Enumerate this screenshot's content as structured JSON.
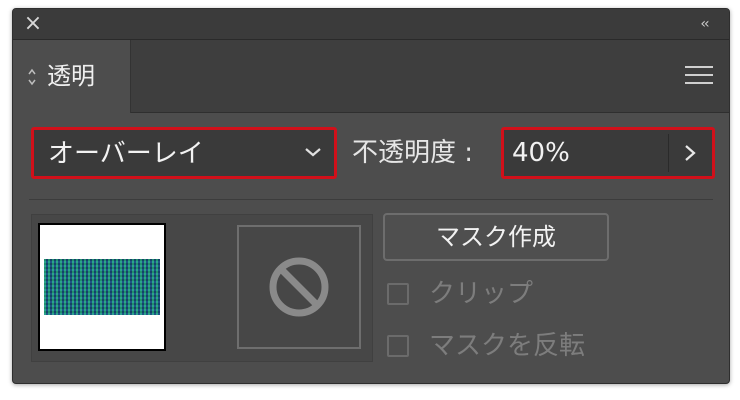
{
  "titlebar": {
    "close_icon": "close-icon",
    "collapse_label": "‹‹"
  },
  "tab": {
    "label": "透明",
    "arrows_icon": "up-down-arrows-icon"
  },
  "menu_icon": "hamburger-menu-icon",
  "blend_mode": {
    "value": "オーバーレイ",
    "chevron_icon": "chevron-down-icon"
  },
  "opacity": {
    "label": "不透明度 :",
    "value": "40%",
    "arrow_icon": "chevron-right-icon"
  },
  "mask": {
    "no_mask_icon": "prohibited-icon",
    "make_mask_label": "マスク作成"
  },
  "checkboxes": {
    "clip": {
      "label": "クリップ",
      "checked": false
    },
    "invert": {
      "label": "マスクを反転",
      "checked": false
    }
  },
  "colors": {
    "panel_bg": "#4d4d4d",
    "highlight_border": "#d1101a"
  }
}
